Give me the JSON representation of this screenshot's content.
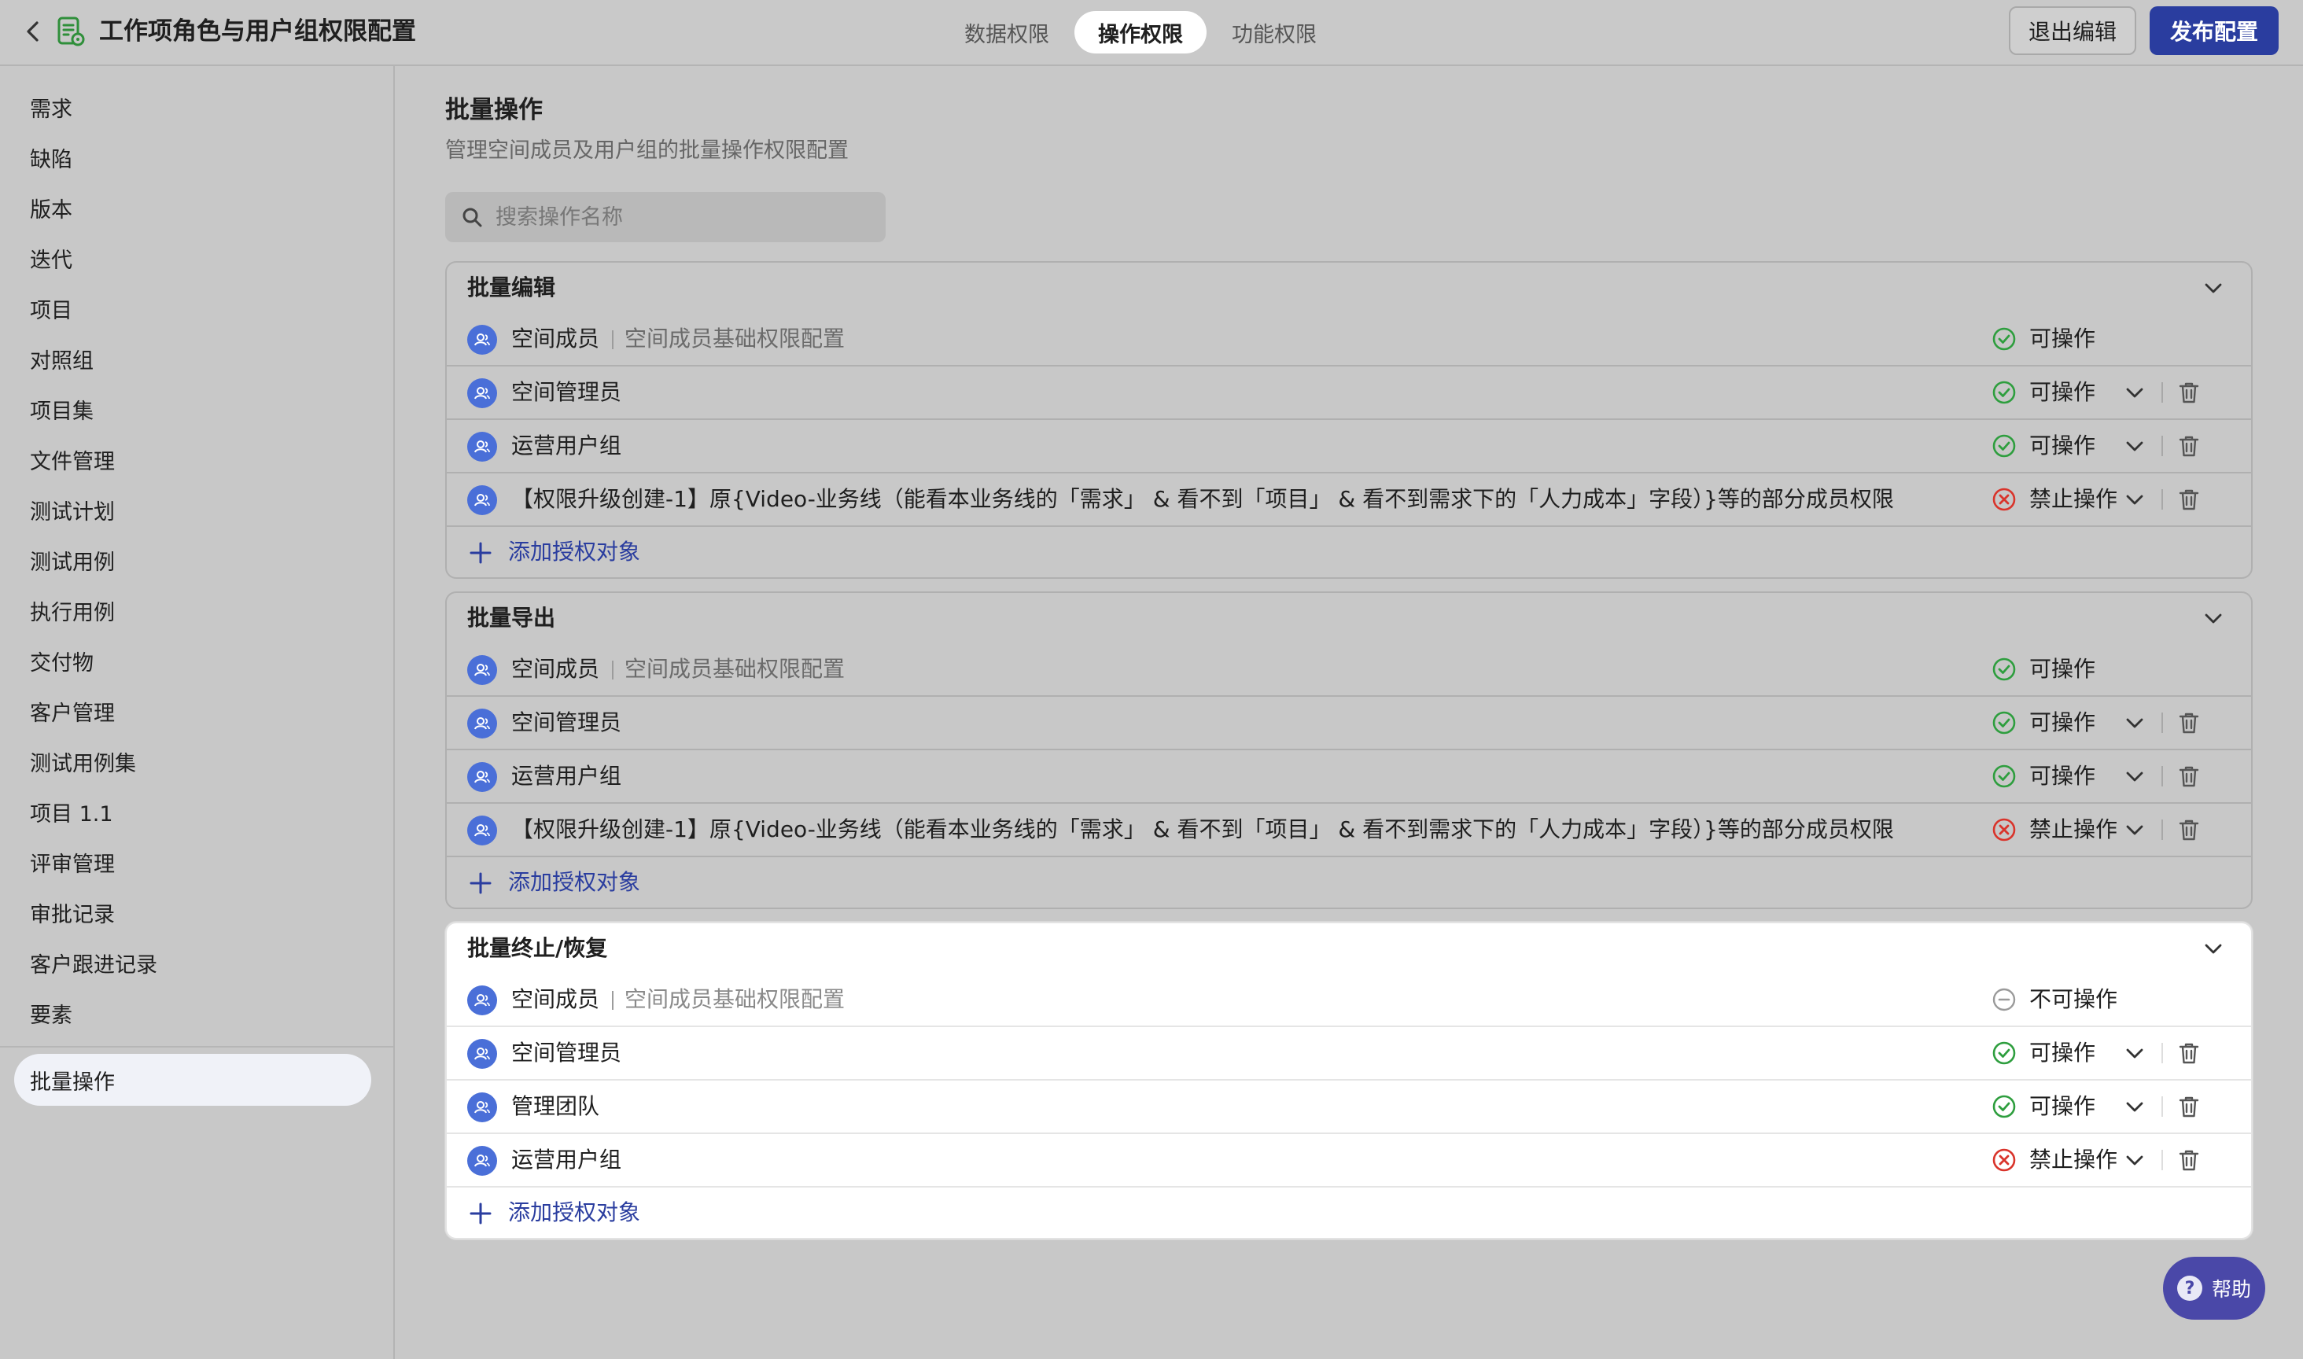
{
  "header": {
    "title": "工作项角色与用户组权限配置",
    "tabs": [
      "数据权限",
      "操作权限",
      "功能权限"
    ],
    "active_tab": "操作权限",
    "exit_label": "退出编辑",
    "publish_label": "发布配置"
  },
  "sidebar": {
    "items": [
      "需求",
      "缺陷",
      "版本",
      "迭代",
      "项目",
      "对照组",
      "项目集",
      "文件管理",
      "测试计划",
      "测试用例",
      "执行用例",
      "交付物",
      "客户管理",
      "测试用例集",
      "项目 1.1",
      "评审管理",
      "审批记录",
      "客户跟进记录",
      "要素"
    ],
    "active": "批量操作"
  },
  "main": {
    "title": "批量操作",
    "subtitle": "管理空间成员及用户组的批量操作权限配置",
    "search_placeholder": "搜索操作名称",
    "add_label": "添加授权对象",
    "sections": [
      {
        "title": "批量编辑",
        "rows": [
          {
            "name": "空间成员",
            "desc": "空间成员基础权限配置",
            "status": "可操作",
            "kind": "allow",
            "editable": false
          },
          {
            "name": "空间管理员",
            "desc": "",
            "status": "可操作",
            "kind": "allow",
            "editable": true
          },
          {
            "name": "运营用户组",
            "desc": "",
            "status": "可操作",
            "kind": "allow",
            "editable": true
          },
          {
            "name": "【权限升级创建-1】原{Video-业务线（能看本业务线的「需求」 & 看不到「项目」 & 看不到需求下的「人力成本」字段）}等的部分成员权限",
            "desc": "",
            "status": "禁止操作",
            "kind": "deny",
            "editable": true
          }
        ]
      },
      {
        "title": "批量导出",
        "rows": [
          {
            "name": "空间成员",
            "desc": "空间成员基础权限配置",
            "status": "可操作",
            "kind": "allow",
            "editable": false
          },
          {
            "name": "空间管理员",
            "desc": "",
            "status": "可操作",
            "kind": "allow",
            "editable": true
          },
          {
            "name": "运营用户组",
            "desc": "",
            "status": "可操作",
            "kind": "allow",
            "editable": true
          },
          {
            "name": "【权限升级创建-1】原{Video-业务线（能看本业务线的「需求」 & 看不到「项目」 & 看不到需求下的「人力成本」字段）}等的部分成员权限",
            "desc": "",
            "status": "禁止操作",
            "kind": "deny",
            "editable": true
          }
        ]
      },
      {
        "title": "批量终止/恢复",
        "highlight": true,
        "rows": [
          {
            "name": "空间成员",
            "desc": "空间成员基础权限配置",
            "status": "不可操作",
            "kind": "none",
            "editable": false
          },
          {
            "name": "空间管理员",
            "desc": "",
            "status": "可操作",
            "kind": "allow",
            "editable": true
          },
          {
            "name": "管理团队",
            "desc": "",
            "status": "可操作",
            "kind": "allow",
            "editable": true
          },
          {
            "name": "运营用户组",
            "desc": "",
            "status": "禁止操作",
            "kind": "deny",
            "editable": true
          }
        ]
      }
    ]
  },
  "help_label": "帮助",
  "colors": {
    "accent": "#2a3d9f",
    "allow": "#2e9e3e",
    "deny": "#d9342b",
    "none": "#9a9a9a",
    "avatar": "#4a6fd8"
  }
}
